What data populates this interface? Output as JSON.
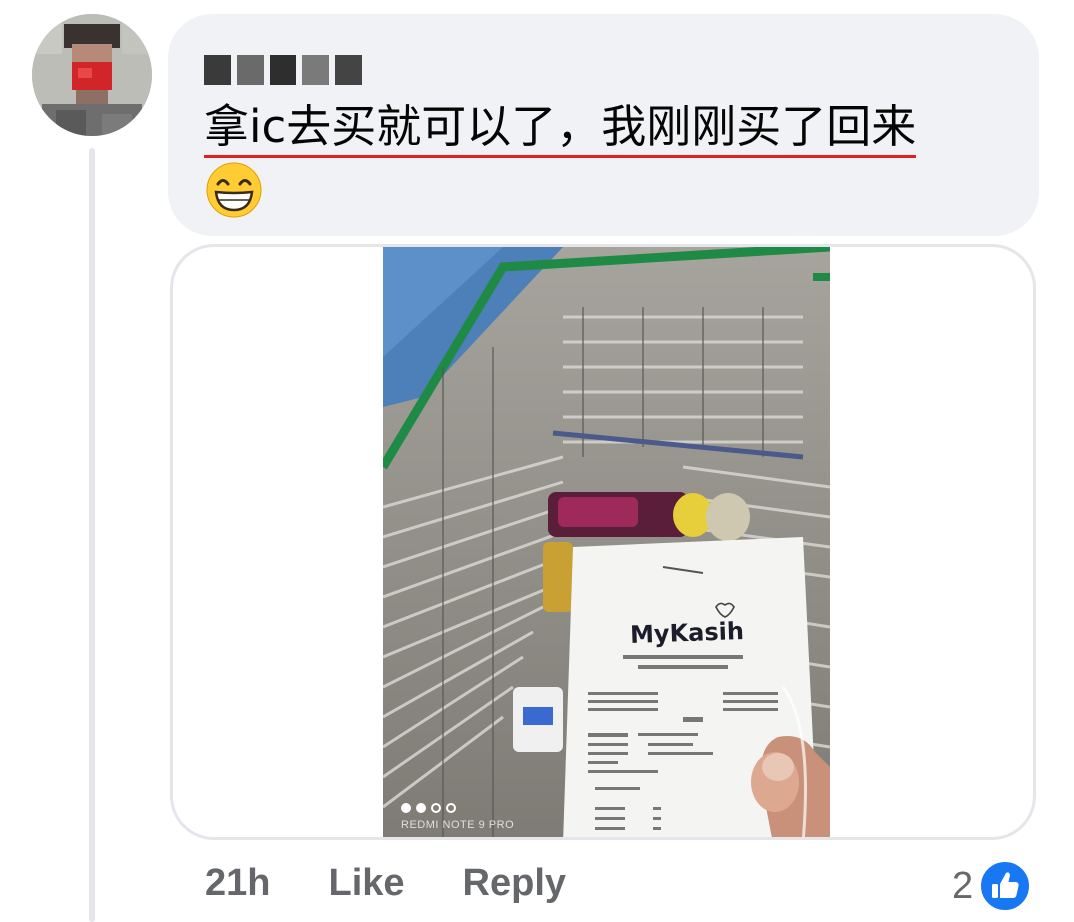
{
  "comment": {
    "author_name": "■■■■■",
    "text_underlined": "拿ic去买就可以了，我刚刚买了回来",
    "emoji": "grinning-face-with-smiling-eyes"
  },
  "attachment": {
    "receipt_brand": "MyKasih",
    "camera_watermark": "REDMI NOTE 9 PRO",
    "carousel": {
      "total": 4,
      "current": 1
    }
  },
  "actions": {
    "timestamp": "21h",
    "like_label": "Like",
    "reply_label": "Reply"
  },
  "reactions": {
    "count": "2",
    "icon": "thumbs-up-icon"
  },
  "colors": {
    "bubble_bg": "#f0f2f5",
    "action_text": "#65676b",
    "like_blue": "#1877f2",
    "underline_red": "#e02020"
  }
}
